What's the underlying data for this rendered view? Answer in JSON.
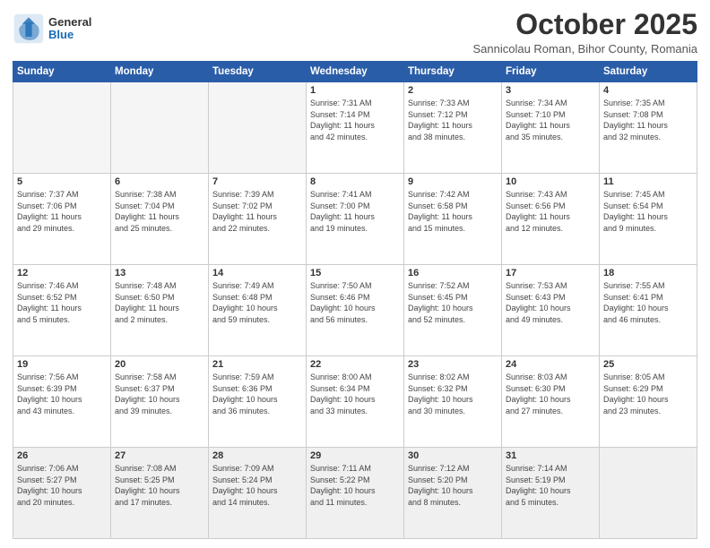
{
  "logo": {
    "general": "General",
    "blue": "Blue"
  },
  "header": {
    "month": "October 2025",
    "subtitle": "Sannicolau Roman, Bihor County, Romania"
  },
  "weekdays": [
    "Sunday",
    "Monday",
    "Tuesday",
    "Wednesday",
    "Thursday",
    "Friday",
    "Saturday"
  ],
  "weeks": [
    [
      {
        "day": "",
        "detail": ""
      },
      {
        "day": "",
        "detail": ""
      },
      {
        "day": "",
        "detail": ""
      },
      {
        "day": "1",
        "detail": "Sunrise: 7:31 AM\nSunset: 7:14 PM\nDaylight: 11 hours\nand 42 minutes."
      },
      {
        "day": "2",
        "detail": "Sunrise: 7:33 AM\nSunset: 7:12 PM\nDaylight: 11 hours\nand 38 minutes."
      },
      {
        "day": "3",
        "detail": "Sunrise: 7:34 AM\nSunset: 7:10 PM\nDaylight: 11 hours\nand 35 minutes."
      },
      {
        "day": "4",
        "detail": "Sunrise: 7:35 AM\nSunset: 7:08 PM\nDaylight: 11 hours\nand 32 minutes."
      }
    ],
    [
      {
        "day": "5",
        "detail": "Sunrise: 7:37 AM\nSunset: 7:06 PM\nDaylight: 11 hours\nand 29 minutes."
      },
      {
        "day": "6",
        "detail": "Sunrise: 7:38 AM\nSunset: 7:04 PM\nDaylight: 11 hours\nand 25 minutes."
      },
      {
        "day": "7",
        "detail": "Sunrise: 7:39 AM\nSunset: 7:02 PM\nDaylight: 11 hours\nand 22 minutes."
      },
      {
        "day": "8",
        "detail": "Sunrise: 7:41 AM\nSunset: 7:00 PM\nDaylight: 11 hours\nand 19 minutes."
      },
      {
        "day": "9",
        "detail": "Sunrise: 7:42 AM\nSunset: 6:58 PM\nDaylight: 11 hours\nand 15 minutes."
      },
      {
        "day": "10",
        "detail": "Sunrise: 7:43 AM\nSunset: 6:56 PM\nDaylight: 11 hours\nand 12 minutes."
      },
      {
        "day": "11",
        "detail": "Sunrise: 7:45 AM\nSunset: 6:54 PM\nDaylight: 11 hours\nand 9 minutes."
      }
    ],
    [
      {
        "day": "12",
        "detail": "Sunrise: 7:46 AM\nSunset: 6:52 PM\nDaylight: 11 hours\nand 5 minutes."
      },
      {
        "day": "13",
        "detail": "Sunrise: 7:48 AM\nSunset: 6:50 PM\nDaylight: 11 hours\nand 2 minutes."
      },
      {
        "day": "14",
        "detail": "Sunrise: 7:49 AM\nSunset: 6:48 PM\nDaylight: 10 hours\nand 59 minutes."
      },
      {
        "day": "15",
        "detail": "Sunrise: 7:50 AM\nSunset: 6:46 PM\nDaylight: 10 hours\nand 56 minutes."
      },
      {
        "day": "16",
        "detail": "Sunrise: 7:52 AM\nSunset: 6:45 PM\nDaylight: 10 hours\nand 52 minutes."
      },
      {
        "day": "17",
        "detail": "Sunrise: 7:53 AM\nSunset: 6:43 PM\nDaylight: 10 hours\nand 49 minutes."
      },
      {
        "day": "18",
        "detail": "Sunrise: 7:55 AM\nSunset: 6:41 PM\nDaylight: 10 hours\nand 46 minutes."
      }
    ],
    [
      {
        "day": "19",
        "detail": "Sunrise: 7:56 AM\nSunset: 6:39 PM\nDaylight: 10 hours\nand 43 minutes."
      },
      {
        "day": "20",
        "detail": "Sunrise: 7:58 AM\nSunset: 6:37 PM\nDaylight: 10 hours\nand 39 minutes."
      },
      {
        "day": "21",
        "detail": "Sunrise: 7:59 AM\nSunset: 6:36 PM\nDaylight: 10 hours\nand 36 minutes."
      },
      {
        "day": "22",
        "detail": "Sunrise: 8:00 AM\nSunset: 6:34 PM\nDaylight: 10 hours\nand 33 minutes."
      },
      {
        "day": "23",
        "detail": "Sunrise: 8:02 AM\nSunset: 6:32 PM\nDaylight: 10 hours\nand 30 minutes."
      },
      {
        "day": "24",
        "detail": "Sunrise: 8:03 AM\nSunset: 6:30 PM\nDaylight: 10 hours\nand 27 minutes."
      },
      {
        "day": "25",
        "detail": "Sunrise: 8:05 AM\nSunset: 6:29 PM\nDaylight: 10 hours\nand 23 minutes."
      }
    ],
    [
      {
        "day": "26",
        "detail": "Sunrise: 7:06 AM\nSunset: 5:27 PM\nDaylight: 10 hours\nand 20 minutes."
      },
      {
        "day": "27",
        "detail": "Sunrise: 7:08 AM\nSunset: 5:25 PM\nDaylight: 10 hours\nand 17 minutes."
      },
      {
        "day": "28",
        "detail": "Sunrise: 7:09 AM\nSunset: 5:24 PM\nDaylight: 10 hours\nand 14 minutes."
      },
      {
        "day": "29",
        "detail": "Sunrise: 7:11 AM\nSunset: 5:22 PM\nDaylight: 10 hours\nand 11 minutes."
      },
      {
        "day": "30",
        "detail": "Sunrise: 7:12 AM\nSunset: 5:20 PM\nDaylight: 10 hours\nand 8 minutes."
      },
      {
        "day": "31",
        "detail": "Sunrise: 7:14 AM\nSunset: 5:19 PM\nDaylight: 10 hours\nand 5 minutes."
      },
      {
        "day": "",
        "detail": ""
      }
    ]
  ]
}
